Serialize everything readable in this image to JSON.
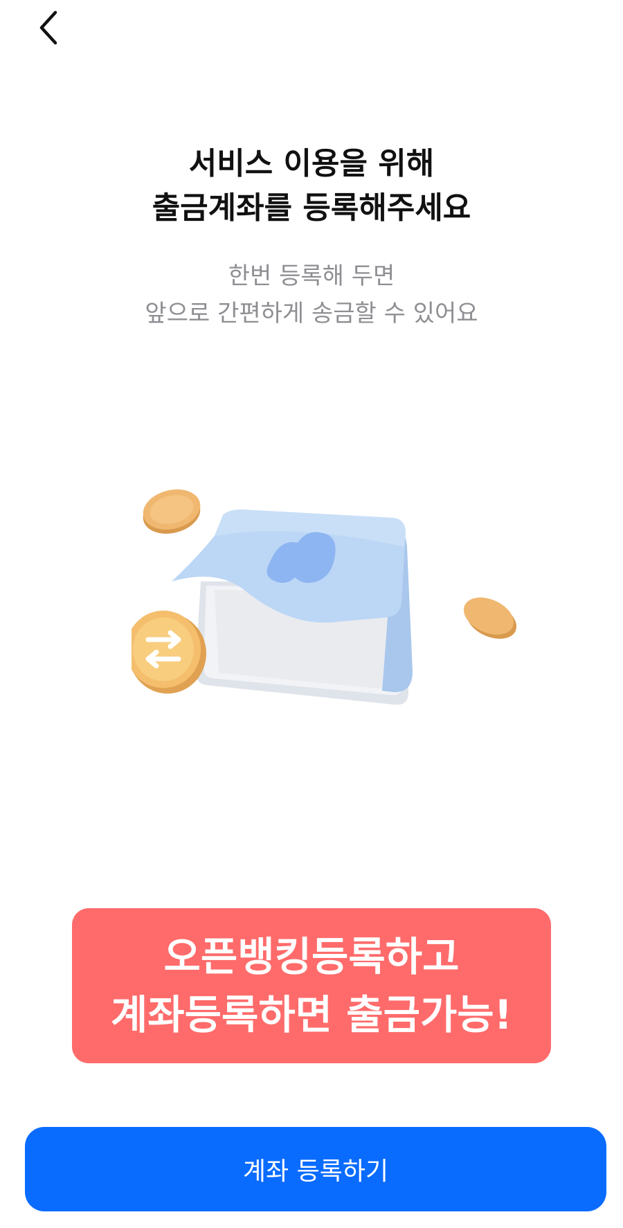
{
  "header": {
    "back_icon": "chevron-left-icon"
  },
  "title": {
    "line1": "서비스 이용을 위해",
    "line2": "출금계좌를 등록해주세요"
  },
  "subtitle": {
    "line1": "한번 등록해 두면",
    "line2": "앞으로 간편하게 송금할 수 있어요"
  },
  "illustration": {
    "icon": "wallet-with-coins-icon",
    "colors": {
      "wallet_front": "#b9d6f7",
      "wallet_pages": "#e6e8ec",
      "logo": "#8fb6f2",
      "coin": "#f0b770",
      "coin_light": "#f8cd7e"
    }
  },
  "promo": {
    "line1": "오픈뱅킹등록하고",
    "line2": "계좌등록하면 출금가능!",
    "color": "#ff6b6b"
  },
  "cta": {
    "label": "계좌 등록하기",
    "color": "#0a6cff"
  }
}
